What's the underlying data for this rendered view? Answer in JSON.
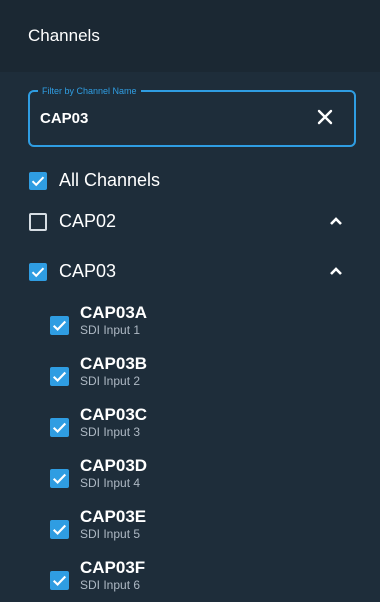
{
  "header": {
    "title": "Channels"
  },
  "filter": {
    "legend": "Filter by Channel Name",
    "value": "CAP03"
  },
  "all_channels": {
    "label": "All Channels",
    "checked": true
  },
  "groups": [
    {
      "label": "CAP02",
      "checked": false,
      "icon": "chevron-up-icon"
    },
    {
      "label": "CAP03",
      "checked": true,
      "icon": "chevron-up-icon"
    }
  ],
  "channels": [
    {
      "name": "CAP03A",
      "input": "SDI Input 1",
      "checked": true
    },
    {
      "name": "CAP03B",
      "input": "SDI Input 2",
      "checked": true
    },
    {
      "name": "CAP03C",
      "input": "SDI Input 3",
      "checked": true
    },
    {
      "name": "CAP03D",
      "input": "SDI Input 4",
      "checked": true
    },
    {
      "name": "CAP03E",
      "input": "SDI Input 5",
      "checked": true
    },
    {
      "name": "CAP03F",
      "input": "SDI Input 6",
      "checked": true
    }
  ],
  "colors": {
    "accent": "#2f9de2",
    "background": "#1e2d3a",
    "header": "#1b2833"
  }
}
